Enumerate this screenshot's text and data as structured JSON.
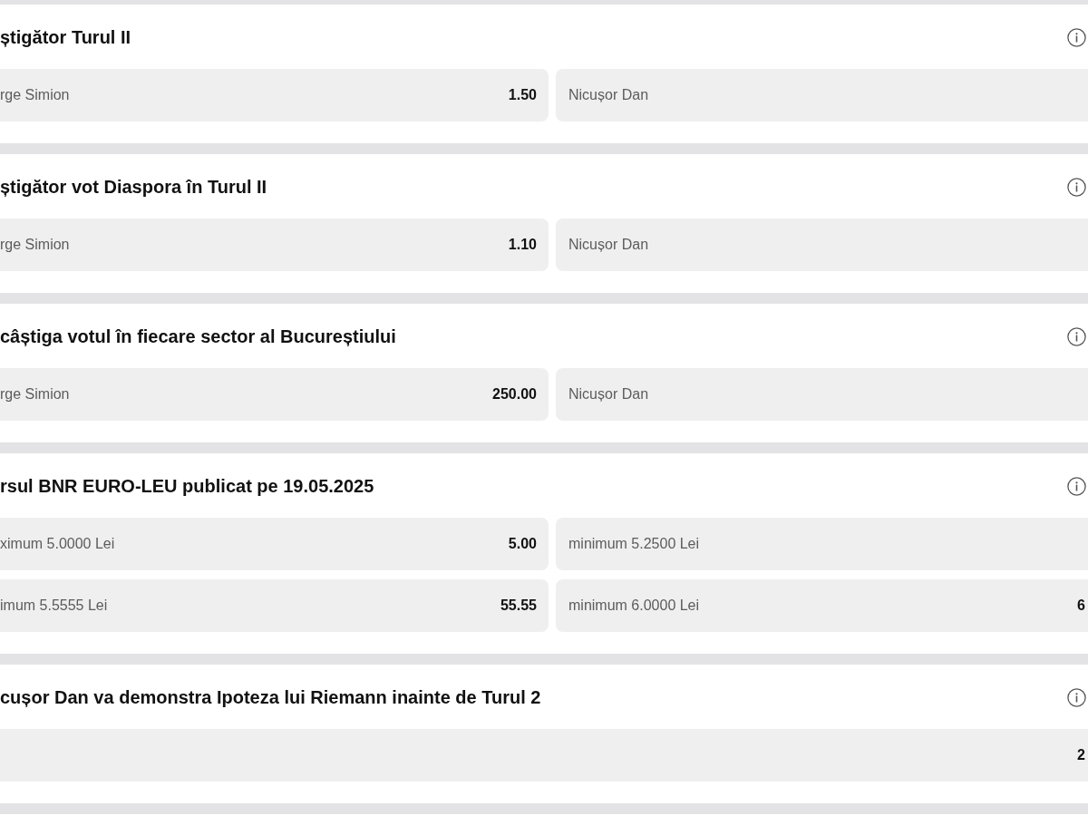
{
  "markets": [
    {
      "title": "știgător Turul II",
      "options": [
        {
          "label": "rge Simion",
          "odds": "1.50"
        },
        {
          "label": "Nicușor Dan"
        }
      ]
    },
    {
      "title": "știgător vot Diaspora în Turul II",
      "options": [
        {
          "label": "rge Simion",
          "odds": "1.10"
        },
        {
          "label": "Nicușor Dan"
        }
      ]
    },
    {
      "title": "câștiga votul în fiecare sector al Bucureștiului",
      "options": [
        {
          "label": "rge Simion",
          "odds": "250.00"
        },
        {
          "label": "Nicușor Dan"
        }
      ]
    },
    {
      "title": "rsul BNR EURO-LEU publicat pe 19.05.2025",
      "options": [
        {
          "label": "ximum 5.0000 Lei",
          "odds": "5.00"
        },
        {
          "label": "minimum 5.2500 Lei"
        },
        {
          "label": "imum 5.5555 Lei",
          "odds": "55.55"
        },
        {
          "label": "minimum 6.0000 Lei",
          "odds": "6"
        }
      ]
    },
    {
      "title": "cușor Dan va demonstra Ipoteza lui Riemann inainte de Turul 2",
      "options": [
        {
          "odds": "2"
        }
      ]
    }
  ]
}
